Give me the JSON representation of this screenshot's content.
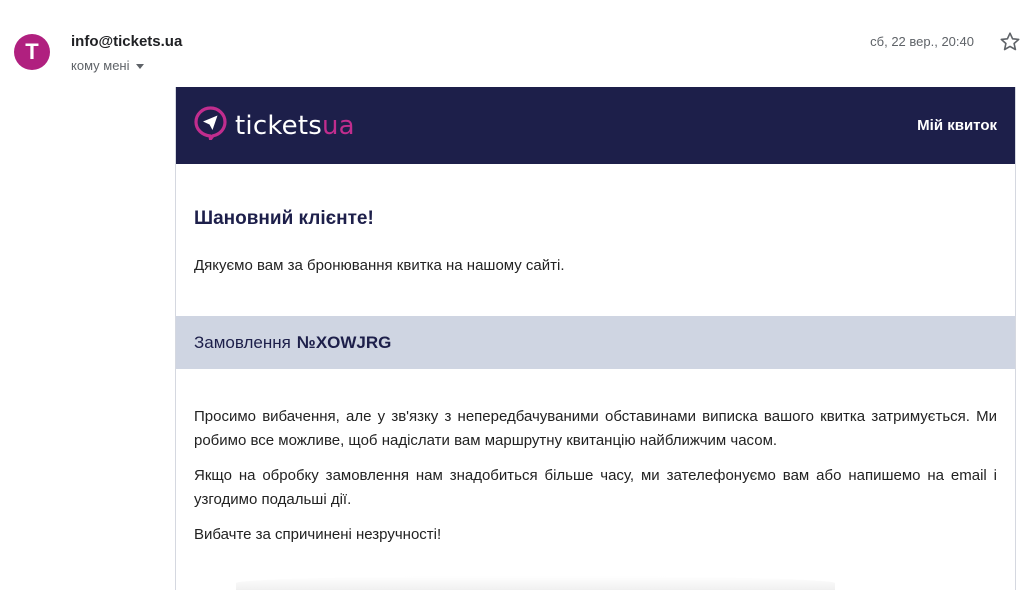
{
  "email": {
    "avatar_letter": "T",
    "sender": "info@tickets.ua",
    "recipient": "кому мені",
    "date": "сб, 22 вер., 20:40"
  },
  "banner": {
    "logo_main": "tickets",
    "logo_accent": "ua",
    "my_ticket_label": "Мій квиток"
  },
  "body": {
    "greeting": "Шановний клієнте!",
    "thanks": "Дякуємо вам за бронювання квитка на нашому сайті.",
    "order_label": "Замовлення",
    "order_number": "№XOWJRG",
    "paragraphs": [
      "Просимо вибачення, але у зв'язку з непередбачуваними обставинами виписка вашого квитка затримується. Ми робимо все можливе, щоб надіслати вам маршрутну квитанцію найближчим часом.",
      "Якщо на обробку замовлення нам знадобиться більше часу, ми зателефонуємо вам або напишемо на email і узгодимо подальші дії.",
      "Вибачте за спричинені незручності!"
    ]
  },
  "colors": {
    "avatar": "#b0207f",
    "banner": "#1d1f4a",
    "logo_accent": "#c12d8e",
    "order_bar": "#cfd5e2"
  },
  "icons": {
    "star": "star-icon",
    "dropdown": "chevron-down-icon",
    "logo": "paper-plane-pin-icon"
  }
}
